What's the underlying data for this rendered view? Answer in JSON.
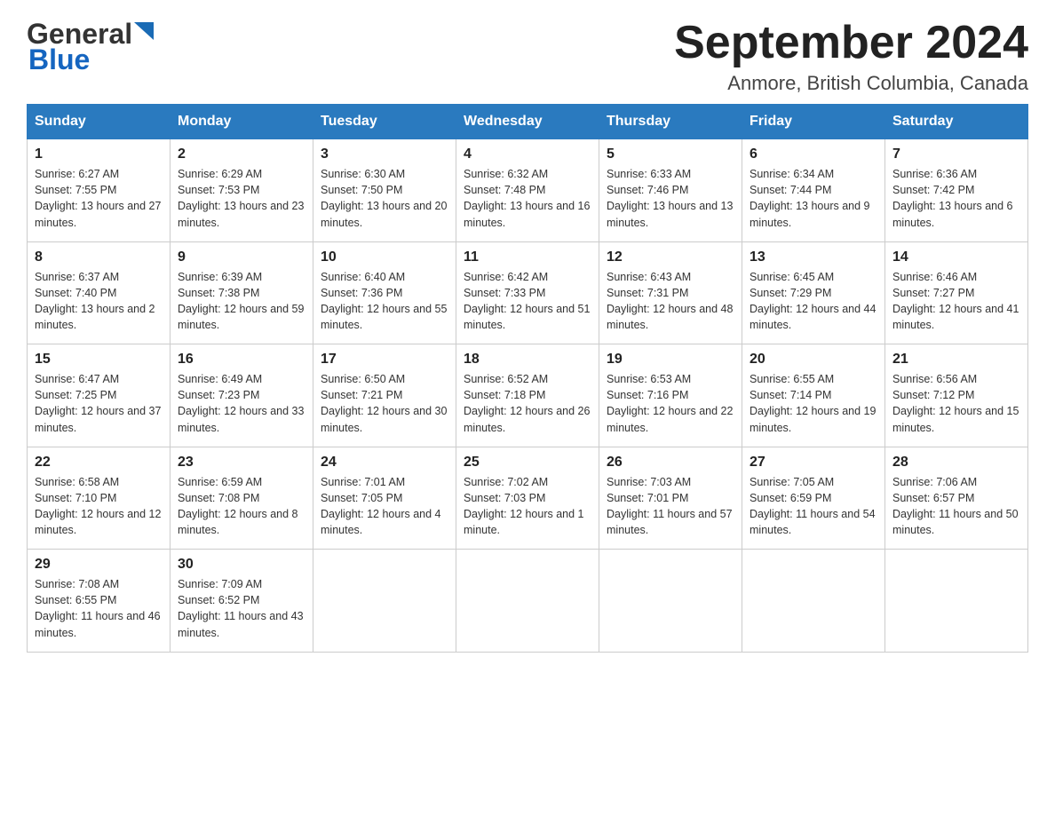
{
  "header": {
    "logo_general": "General",
    "logo_blue": "Blue",
    "month_title": "September 2024",
    "location": "Anmore, British Columbia, Canada"
  },
  "days_of_week": [
    "Sunday",
    "Monday",
    "Tuesday",
    "Wednesday",
    "Thursday",
    "Friday",
    "Saturday"
  ],
  "weeks": [
    [
      {
        "day": "1",
        "sunrise": "Sunrise: 6:27 AM",
        "sunset": "Sunset: 7:55 PM",
        "daylight": "Daylight: 13 hours and 27 minutes."
      },
      {
        "day": "2",
        "sunrise": "Sunrise: 6:29 AM",
        "sunset": "Sunset: 7:53 PM",
        "daylight": "Daylight: 13 hours and 23 minutes."
      },
      {
        "day": "3",
        "sunrise": "Sunrise: 6:30 AM",
        "sunset": "Sunset: 7:50 PM",
        "daylight": "Daylight: 13 hours and 20 minutes."
      },
      {
        "day": "4",
        "sunrise": "Sunrise: 6:32 AM",
        "sunset": "Sunset: 7:48 PM",
        "daylight": "Daylight: 13 hours and 16 minutes."
      },
      {
        "day": "5",
        "sunrise": "Sunrise: 6:33 AM",
        "sunset": "Sunset: 7:46 PM",
        "daylight": "Daylight: 13 hours and 13 minutes."
      },
      {
        "day": "6",
        "sunrise": "Sunrise: 6:34 AM",
        "sunset": "Sunset: 7:44 PM",
        "daylight": "Daylight: 13 hours and 9 minutes."
      },
      {
        "day": "7",
        "sunrise": "Sunrise: 6:36 AM",
        "sunset": "Sunset: 7:42 PM",
        "daylight": "Daylight: 13 hours and 6 minutes."
      }
    ],
    [
      {
        "day": "8",
        "sunrise": "Sunrise: 6:37 AM",
        "sunset": "Sunset: 7:40 PM",
        "daylight": "Daylight: 13 hours and 2 minutes."
      },
      {
        "day": "9",
        "sunrise": "Sunrise: 6:39 AM",
        "sunset": "Sunset: 7:38 PM",
        "daylight": "Daylight: 12 hours and 59 minutes."
      },
      {
        "day": "10",
        "sunrise": "Sunrise: 6:40 AM",
        "sunset": "Sunset: 7:36 PM",
        "daylight": "Daylight: 12 hours and 55 minutes."
      },
      {
        "day": "11",
        "sunrise": "Sunrise: 6:42 AM",
        "sunset": "Sunset: 7:33 PM",
        "daylight": "Daylight: 12 hours and 51 minutes."
      },
      {
        "day": "12",
        "sunrise": "Sunrise: 6:43 AM",
        "sunset": "Sunset: 7:31 PM",
        "daylight": "Daylight: 12 hours and 48 minutes."
      },
      {
        "day": "13",
        "sunrise": "Sunrise: 6:45 AM",
        "sunset": "Sunset: 7:29 PM",
        "daylight": "Daylight: 12 hours and 44 minutes."
      },
      {
        "day": "14",
        "sunrise": "Sunrise: 6:46 AM",
        "sunset": "Sunset: 7:27 PM",
        "daylight": "Daylight: 12 hours and 41 minutes."
      }
    ],
    [
      {
        "day": "15",
        "sunrise": "Sunrise: 6:47 AM",
        "sunset": "Sunset: 7:25 PM",
        "daylight": "Daylight: 12 hours and 37 minutes."
      },
      {
        "day": "16",
        "sunrise": "Sunrise: 6:49 AM",
        "sunset": "Sunset: 7:23 PM",
        "daylight": "Daylight: 12 hours and 33 minutes."
      },
      {
        "day": "17",
        "sunrise": "Sunrise: 6:50 AM",
        "sunset": "Sunset: 7:21 PM",
        "daylight": "Daylight: 12 hours and 30 minutes."
      },
      {
        "day": "18",
        "sunrise": "Sunrise: 6:52 AM",
        "sunset": "Sunset: 7:18 PM",
        "daylight": "Daylight: 12 hours and 26 minutes."
      },
      {
        "day": "19",
        "sunrise": "Sunrise: 6:53 AM",
        "sunset": "Sunset: 7:16 PM",
        "daylight": "Daylight: 12 hours and 22 minutes."
      },
      {
        "day": "20",
        "sunrise": "Sunrise: 6:55 AM",
        "sunset": "Sunset: 7:14 PM",
        "daylight": "Daylight: 12 hours and 19 minutes."
      },
      {
        "day": "21",
        "sunrise": "Sunrise: 6:56 AM",
        "sunset": "Sunset: 7:12 PM",
        "daylight": "Daylight: 12 hours and 15 minutes."
      }
    ],
    [
      {
        "day": "22",
        "sunrise": "Sunrise: 6:58 AM",
        "sunset": "Sunset: 7:10 PM",
        "daylight": "Daylight: 12 hours and 12 minutes."
      },
      {
        "day": "23",
        "sunrise": "Sunrise: 6:59 AM",
        "sunset": "Sunset: 7:08 PM",
        "daylight": "Daylight: 12 hours and 8 minutes."
      },
      {
        "day": "24",
        "sunrise": "Sunrise: 7:01 AM",
        "sunset": "Sunset: 7:05 PM",
        "daylight": "Daylight: 12 hours and 4 minutes."
      },
      {
        "day": "25",
        "sunrise": "Sunrise: 7:02 AM",
        "sunset": "Sunset: 7:03 PM",
        "daylight": "Daylight: 12 hours and 1 minute."
      },
      {
        "day": "26",
        "sunrise": "Sunrise: 7:03 AM",
        "sunset": "Sunset: 7:01 PM",
        "daylight": "Daylight: 11 hours and 57 minutes."
      },
      {
        "day": "27",
        "sunrise": "Sunrise: 7:05 AM",
        "sunset": "Sunset: 6:59 PM",
        "daylight": "Daylight: 11 hours and 54 minutes."
      },
      {
        "day": "28",
        "sunrise": "Sunrise: 7:06 AM",
        "sunset": "Sunset: 6:57 PM",
        "daylight": "Daylight: 11 hours and 50 minutes."
      }
    ],
    [
      {
        "day": "29",
        "sunrise": "Sunrise: 7:08 AM",
        "sunset": "Sunset: 6:55 PM",
        "daylight": "Daylight: 11 hours and 46 minutes."
      },
      {
        "day": "30",
        "sunrise": "Sunrise: 7:09 AM",
        "sunset": "Sunset: 6:52 PM",
        "daylight": "Daylight: 11 hours and 43 minutes."
      },
      null,
      null,
      null,
      null,
      null
    ]
  ]
}
